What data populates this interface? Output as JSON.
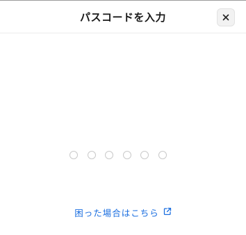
{
  "dialog": {
    "title": "パスコードを入力",
    "close_icon": "close-icon",
    "passcode": {
      "length": 6,
      "filled": 0
    },
    "help": {
      "label": "困った場合はこちら",
      "icon": "external-link-icon"
    }
  },
  "colors": {
    "link": "#1a6ee0",
    "dot_border": "#c9c9c9",
    "title": "#1a1a1a"
  }
}
